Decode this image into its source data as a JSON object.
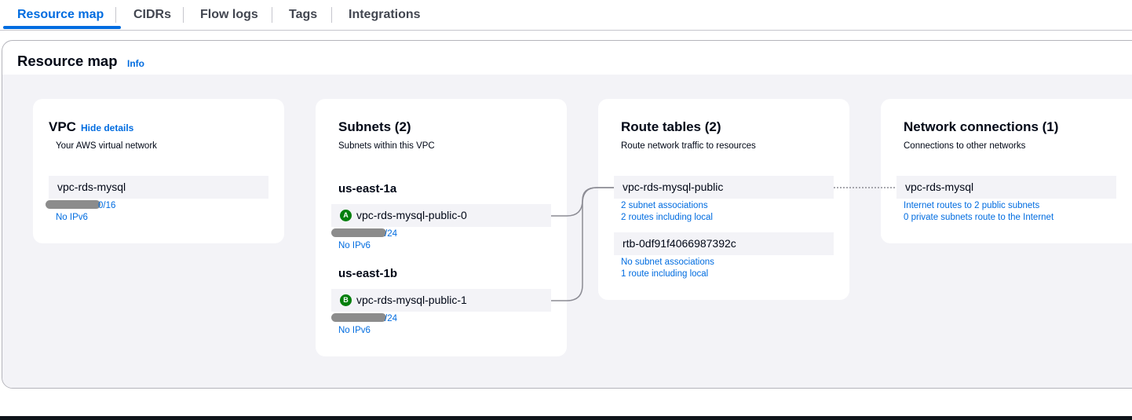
{
  "tabs": [
    {
      "label": "Resource map",
      "active": true
    },
    {
      "label": "CIDRs",
      "active": false
    },
    {
      "label": "Flow logs",
      "active": false
    },
    {
      "label": "Tags",
      "active": false
    },
    {
      "label": "Integrations",
      "active": false
    }
  ],
  "header": {
    "title": "Resource map",
    "info": "Info"
  },
  "vpc": {
    "title": "VPC",
    "hide_details": "Hide details",
    "description": "Your AWS virtual network",
    "item": {
      "name": "vpc-rds-mysql",
      "cidr_suffix": "0/16",
      "ipv6": "No IPv6"
    }
  },
  "subnets": {
    "title": "Subnets (2)",
    "description": "Subnets within this VPC",
    "zones": [
      {
        "az": "us-east-1a",
        "badge": "A",
        "name": "vpc-rds-mysql-public-0",
        "cidr_suffix": "/24",
        "ipv6": "No IPv6"
      },
      {
        "az": "us-east-1b",
        "badge": "B",
        "name": "vpc-rds-mysql-public-1",
        "cidr_suffix": "/24",
        "ipv6": "No IPv6"
      }
    ]
  },
  "route_tables": {
    "title": "Route tables (2)",
    "description": "Route network traffic to resources",
    "items": [
      {
        "name": "vpc-rds-mysql-public",
        "associations": "2 subnet associations",
        "routes": "2 routes including local"
      },
      {
        "name": "rtb-0df91f4066987392c",
        "associations": "No subnet associations",
        "routes": "1 route including local"
      }
    ]
  },
  "network_connections": {
    "title": "Network connections (1)",
    "description": "Connections to other networks",
    "item": {
      "name": "vpc-rds-mysql",
      "line1": "Internet routes to 2 public subnets",
      "line2": "0 private subnets route to the Internet"
    }
  },
  "colors": {
    "accent": "#006ce0",
    "badge": "#037f0c",
    "map_bg": "#f3f3f7",
    "connector": "#8c8c94"
  }
}
